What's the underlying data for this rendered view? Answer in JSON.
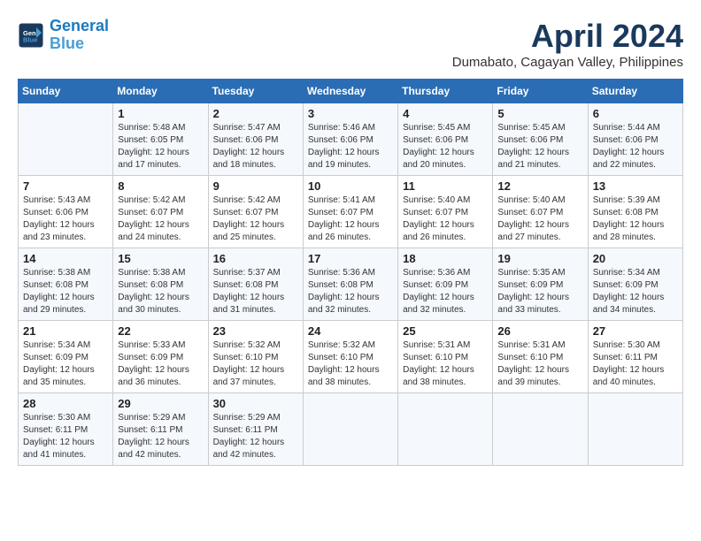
{
  "header": {
    "logo_line1": "General",
    "logo_line2": "Blue",
    "month": "April 2024",
    "location": "Dumabato, Cagayan Valley, Philippines"
  },
  "days_of_week": [
    "Sunday",
    "Monday",
    "Tuesday",
    "Wednesday",
    "Thursday",
    "Friday",
    "Saturday"
  ],
  "weeks": [
    [
      {
        "day": "",
        "info": ""
      },
      {
        "day": "1",
        "info": "Sunrise: 5:48 AM\nSunset: 6:05 PM\nDaylight: 12 hours\nand 17 minutes."
      },
      {
        "day": "2",
        "info": "Sunrise: 5:47 AM\nSunset: 6:06 PM\nDaylight: 12 hours\nand 18 minutes."
      },
      {
        "day": "3",
        "info": "Sunrise: 5:46 AM\nSunset: 6:06 PM\nDaylight: 12 hours\nand 19 minutes."
      },
      {
        "day": "4",
        "info": "Sunrise: 5:45 AM\nSunset: 6:06 PM\nDaylight: 12 hours\nand 20 minutes."
      },
      {
        "day": "5",
        "info": "Sunrise: 5:45 AM\nSunset: 6:06 PM\nDaylight: 12 hours\nand 21 minutes."
      },
      {
        "day": "6",
        "info": "Sunrise: 5:44 AM\nSunset: 6:06 PM\nDaylight: 12 hours\nand 22 minutes."
      }
    ],
    [
      {
        "day": "7",
        "info": "Sunrise: 5:43 AM\nSunset: 6:06 PM\nDaylight: 12 hours\nand 23 minutes."
      },
      {
        "day": "8",
        "info": "Sunrise: 5:42 AM\nSunset: 6:07 PM\nDaylight: 12 hours\nand 24 minutes."
      },
      {
        "day": "9",
        "info": "Sunrise: 5:42 AM\nSunset: 6:07 PM\nDaylight: 12 hours\nand 25 minutes."
      },
      {
        "day": "10",
        "info": "Sunrise: 5:41 AM\nSunset: 6:07 PM\nDaylight: 12 hours\nand 26 minutes."
      },
      {
        "day": "11",
        "info": "Sunrise: 5:40 AM\nSunset: 6:07 PM\nDaylight: 12 hours\nand 26 minutes."
      },
      {
        "day": "12",
        "info": "Sunrise: 5:40 AM\nSunset: 6:07 PM\nDaylight: 12 hours\nand 27 minutes."
      },
      {
        "day": "13",
        "info": "Sunrise: 5:39 AM\nSunset: 6:08 PM\nDaylight: 12 hours\nand 28 minutes."
      }
    ],
    [
      {
        "day": "14",
        "info": "Sunrise: 5:38 AM\nSunset: 6:08 PM\nDaylight: 12 hours\nand 29 minutes."
      },
      {
        "day": "15",
        "info": "Sunrise: 5:38 AM\nSunset: 6:08 PM\nDaylight: 12 hours\nand 30 minutes."
      },
      {
        "day": "16",
        "info": "Sunrise: 5:37 AM\nSunset: 6:08 PM\nDaylight: 12 hours\nand 31 minutes."
      },
      {
        "day": "17",
        "info": "Sunrise: 5:36 AM\nSunset: 6:08 PM\nDaylight: 12 hours\nand 32 minutes."
      },
      {
        "day": "18",
        "info": "Sunrise: 5:36 AM\nSunset: 6:09 PM\nDaylight: 12 hours\nand 32 minutes."
      },
      {
        "day": "19",
        "info": "Sunrise: 5:35 AM\nSunset: 6:09 PM\nDaylight: 12 hours\nand 33 minutes."
      },
      {
        "day": "20",
        "info": "Sunrise: 5:34 AM\nSunset: 6:09 PM\nDaylight: 12 hours\nand 34 minutes."
      }
    ],
    [
      {
        "day": "21",
        "info": "Sunrise: 5:34 AM\nSunset: 6:09 PM\nDaylight: 12 hours\nand 35 minutes."
      },
      {
        "day": "22",
        "info": "Sunrise: 5:33 AM\nSunset: 6:09 PM\nDaylight: 12 hours\nand 36 minutes."
      },
      {
        "day": "23",
        "info": "Sunrise: 5:32 AM\nSunset: 6:10 PM\nDaylight: 12 hours\nand 37 minutes."
      },
      {
        "day": "24",
        "info": "Sunrise: 5:32 AM\nSunset: 6:10 PM\nDaylight: 12 hours\nand 38 minutes."
      },
      {
        "day": "25",
        "info": "Sunrise: 5:31 AM\nSunset: 6:10 PM\nDaylight: 12 hours\nand 38 minutes."
      },
      {
        "day": "26",
        "info": "Sunrise: 5:31 AM\nSunset: 6:10 PM\nDaylight: 12 hours\nand 39 minutes."
      },
      {
        "day": "27",
        "info": "Sunrise: 5:30 AM\nSunset: 6:11 PM\nDaylight: 12 hours\nand 40 minutes."
      }
    ],
    [
      {
        "day": "28",
        "info": "Sunrise: 5:30 AM\nSunset: 6:11 PM\nDaylight: 12 hours\nand 41 minutes."
      },
      {
        "day": "29",
        "info": "Sunrise: 5:29 AM\nSunset: 6:11 PM\nDaylight: 12 hours\nand 42 minutes."
      },
      {
        "day": "30",
        "info": "Sunrise: 5:29 AM\nSunset: 6:11 PM\nDaylight: 12 hours\nand 42 minutes."
      },
      {
        "day": "",
        "info": ""
      },
      {
        "day": "",
        "info": ""
      },
      {
        "day": "",
        "info": ""
      },
      {
        "day": "",
        "info": ""
      }
    ]
  ]
}
